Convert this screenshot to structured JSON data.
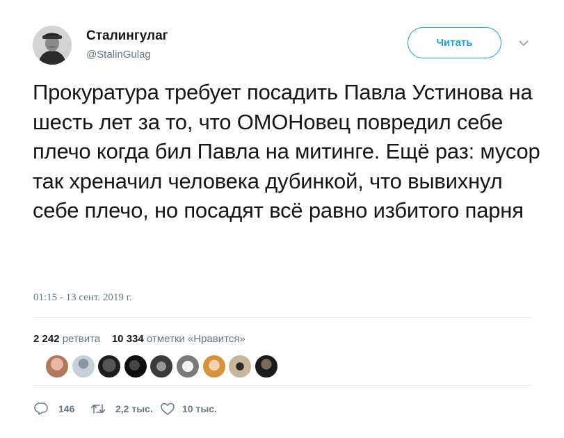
{
  "tweet": {
    "author_name": "Сталингулаг",
    "author_handle": "@StalinGulag",
    "follow_label": "Читать",
    "text": "Прокуратура требует посадить Павла Устинова на шесть лет за то, что ОМОНовец повредил себе плечо когда бил Павла на митинге. Ещё раз: мусор так хреначил человека дубинкой, что вывихнул себе плечо, но посадят всё равно избитого парня",
    "timestamp": "01:15 - 13 сент. 2019 г."
  },
  "stats": {
    "retweets_count": "2 242",
    "retweets_label": "ретвита",
    "likes_count": "10 334",
    "likes_label": "отметки «Нравится»"
  },
  "actions": {
    "replies": "146",
    "retweets": "2,2 тыс.",
    "likes": "10 тыс."
  },
  "colors": {
    "accent": "#1da1f2",
    "secondary_text": "#657786",
    "divider": "#e6ecf0"
  },
  "icons": [
    "chevron-down-icon",
    "reply-icon",
    "retweet-icon",
    "like-icon"
  ]
}
